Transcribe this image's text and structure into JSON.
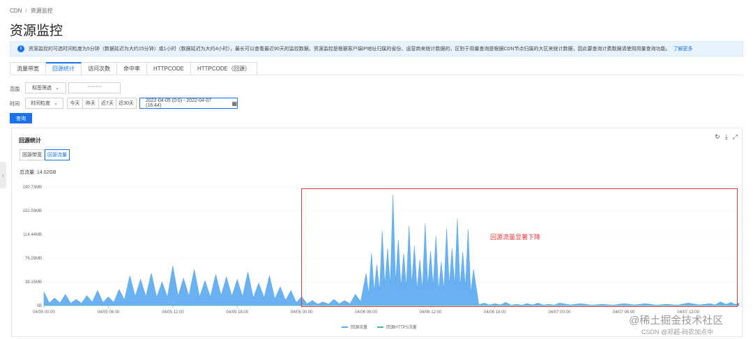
{
  "breadcrumb": {
    "root": "CDN",
    "separator": "/",
    "current": "资源监控"
  },
  "page": {
    "title": "资源监控"
  },
  "notice": {
    "text": "资源监控的可选时间粒度为5分钟（数据延迟为大约15分钟）或1小时（数据延迟为大约4小时），最长可以查看最近90天的监控数据。资源监控是根据客户端IP地址归属的省份、运营商来统计数据的，区别于用量查询是根据CDN节点归属的大区来统计数据，因此要查询计费数据请使用用量查询功能。",
    "link": "了解更多"
  },
  "tabs": [
    {
      "label": "流量带宽",
      "active": false
    },
    {
      "label": "回源统计",
      "active": true
    },
    {
      "label": "访问次数",
      "active": false
    },
    {
      "label": "命中率",
      "active": false
    },
    {
      "label": "HTTPCODE",
      "active": false
    },
    {
      "label": "HTTPCODE（回源）",
      "active": false
    }
  ],
  "filters": {
    "range_label": "范围",
    "range_select": "标签筛选",
    "domain_value": "*** *** *** ***",
    "time_label": "时间",
    "granularity_select": "时间粒度",
    "quick_ranges": [
      "今天",
      "昨天",
      "近7天",
      "近30天"
    ],
    "date_range": "2022-04-05 (0:0) - 2022-04-07 (16:44)",
    "query_label": "查询"
  },
  "panel": {
    "title": "回源统计",
    "subtabs": [
      {
        "label": "回源带宽",
        "active": false
      },
      {
        "label": "回源流量",
        "active": true
      }
    ],
    "total": "总流量: 14.02GB",
    "annotation": "回源流量显著下降"
  },
  "chart_data": {
    "type": "area",
    "y_ticks": [
      "0B",
      "38.15MB",
      "76.29MB",
      "114.44MB",
      "152.59MB",
      "190.73MB"
    ],
    "ylim_mb": [
      0,
      190.73
    ],
    "x_ticks": [
      "04/05 00:00",
      "04/05 06:00",
      "04/05 12:00",
      "04/05 18:00",
      "04/06 00:00",
      "04/06 06:00",
      "04/06 12:00",
      "04/06 18:00",
      "04/07 00:00",
      "04/07 06:00",
      "04/07 12:00"
    ],
    "x_range_hours": [
      0,
      64.73
    ],
    "series": [
      {
        "name": "回源流量",
        "color": "#5aa8f0",
        "x_hours": [
          0,
          1,
          2,
          3,
          4,
          5,
          6,
          7,
          8,
          9,
          10,
          11,
          12,
          13,
          14,
          15,
          16,
          17,
          18,
          19,
          20,
          21,
          22,
          23,
          24,
          25,
          26,
          27,
          28,
          29,
          30,
          30.5,
          31,
          31.5,
          32,
          32.5,
          33,
          33.5,
          34,
          34.5,
          35,
          35.5,
          36,
          36.5,
          37,
          37.5,
          38,
          38.5,
          39,
          39.5,
          40,
          41,
          42,
          43,
          44,
          45,
          46,
          47,
          48,
          50,
          52,
          54,
          56,
          58,
          60,
          62,
          63,
          64,
          64.73
        ],
        "values_mb": [
          22,
          12,
          18,
          10,
          16,
          24,
          14,
          26,
          48,
          42,
          52,
          38,
          64,
          44,
          58,
          40,
          50,
          46,
          42,
          54,
          36,
          48,
          30,
          24,
          14,
          8,
          6,
          10,
          8,
          18,
          52,
          84,
          66,
          120,
          92,
          178,
          106,
          84,
          128,
          96,
          74,
          132,
          88,
          112,
          70,
          124,
          92,
          140,
          86,
          122,
          58,
          4,
          3,
          5,
          2,
          3,
          4,
          2,
          4,
          3,
          2,
          3,
          3,
          2,
          4,
          3,
          6,
          5,
          4
        ]
      },
      {
        "name": "回源HTTPS流量",
        "color": "#3fbf8f",
        "x_hours": [
          0,
          64.73
        ],
        "values_mb": [
          0,
          0
        ]
      }
    ],
    "grid": true,
    "legend": "bottom-center"
  },
  "watermark": {
    "line1": "@稀土掘金技术社区",
    "line2": "CSDN @邓超-码农加点中"
  }
}
